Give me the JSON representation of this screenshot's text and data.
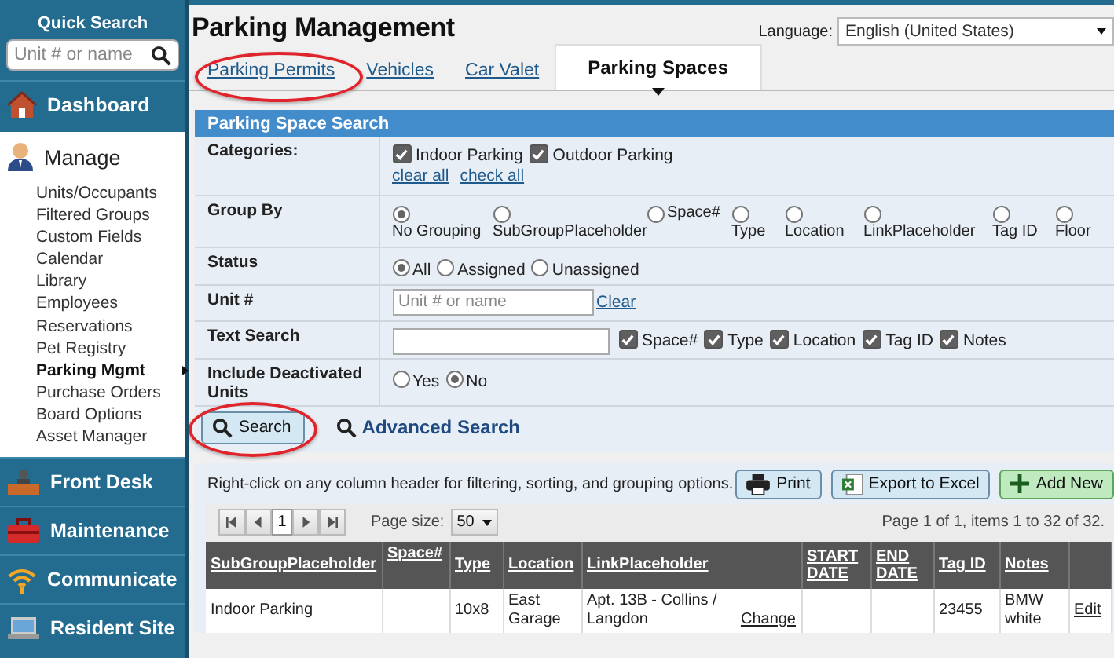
{
  "sidebar": {
    "quick_search": {
      "title": "Quick Search",
      "placeholder": "Unit # or name"
    },
    "sections": [
      {
        "label": "Dashboard",
        "expanded": false
      },
      {
        "label": "Manage",
        "expanded": true,
        "items": [
          {
            "label": "Units/Occupants",
            "selected": false
          },
          {
            "label": "Filtered Groups",
            "selected": false
          },
          {
            "label": "Custom Fields",
            "selected": false
          },
          {
            "label": "Calendar",
            "selected": false
          },
          {
            "label": "Library",
            "selected": false
          },
          {
            "label": "Employees",
            "selected": false
          },
          {
            "label": "Reservations",
            "selected": false
          },
          {
            "label": "Pet Registry",
            "selected": false
          },
          {
            "label": "Parking Mgmt",
            "selected": true
          },
          {
            "label": "Purchase Orders",
            "selected": false
          },
          {
            "label": "Board Options",
            "selected": false
          },
          {
            "label": "Asset Manager",
            "selected": false
          }
        ]
      },
      {
        "label": "Front Desk",
        "expanded": false
      },
      {
        "label": "Maintenance",
        "expanded": false
      },
      {
        "label": "Communicate",
        "expanded": false
      },
      {
        "label": "Resident Site",
        "expanded": false
      }
    ]
  },
  "page": {
    "title": "Parking Management",
    "language": {
      "label": "Language:",
      "value": "English (United States)"
    }
  },
  "tabs": [
    {
      "label": "Parking Permits",
      "selected": false,
      "circled": true
    },
    {
      "label": "Vehicles",
      "selected": false,
      "circled": false
    },
    {
      "label": "Car Valet",
      "selected": false,
      "circled": false
    },
    {
      "label": "Parking Spaces",
      "selected": true,
      "circled": false
    }
  ],
  "search_panel": {
    "title": "Parking Space Search",
    "rows": [
      {
        "kind": "checks",
        "label": "Categories:",
        "options": [
          {
            "label": "Indoor Parking",
            "checked": true
          },
          {
            "label": "Outdoor Parking",
            "checked": true
          }
        ],
        "links": [
          "clear all",
          "check all"
        ]
      },
      {
        "kind": "grouping",
        "label": "Group By",
        "options": [
          {
            "label": "No Grouping",
            "selected": true
          },
          {
            "label": "SubGroupPlaceholder",
            "selected": false
          },
          {
            "label": "Space#",
            "selected": false
          },
          {
            "label": "Type",
            "selected": false
          },
          {
            "label": "Location",
            "selected": false
          },
          {
            "label": "LinkPlaceholder",
            "selected": false
          },
          {
            "label": "Tag ID",
            "selected": false
          },
          {
            "label": "Floor",
            "selected": false
          }
        ]
      },
      {
        "kind": "radios",
        "label": "Status",
        "options": [
          {
            "label": "All",
            "selected": true
          },
          {
            "label": "Assigned",
            "selected": false
          },
          {
            "label": "Unassigned",
            "selected": false
          }
        ]
      },
      {
        "kind": "text",
        "label": "Unit #",
        "placeholder": "Unit # or name",
        "link": "Clear"
      },
      {
        "kind": "textchecks",
        "label": "Text Search",
        "options": [
          {
            "label": "Space#",
            "checked": true
          },
          {
            "label": "Type",
            "checked": true
          },
          {
            "label": "Location",
            "checked": true
          },
          {
            "label": "Tag ID",
            "checked": true
          },
          {
            "label": "Notes",
            "checked": true
          }
        ]
      },
      {
        "kind": "radios",
        "label": "Include Deactivated Units",
        "options": [
          {
            "label": "Yes",
            "selected": false
          },
          {
            "label": "No",
            "selected": true
          }
        ]
      }
    ],
    "search_button": {
      "label": "Search",
      "circled": true
    },
    "advanced_search": "Advanced Search"
  },
  "grid": {
    "hint": "Right-click on any column header for filtering, sorting, and grouping options.",
    "buttons": [
      {
        "kind": "print",
        "label": "Print"
      },
      {
        "kind": "excel",
        "label": "Export to Excel"
      },
      {
        "kind": "add",
        "label": "Add New"
      }
    ],
    "pager": {
      "page": "1",
      "page_size_label": "Page size:",
      "page_size": "50",
      "summary": "Page 1 of 1, items 1 to 32 of 32."
    },
    "columns": [
      "SubGroupPlaceholder",
      "Space#",
      "Type",
      "Location",
      "LinkPlaceholder",
      "START DATE",
      "END DATE",
      "Tag ID",
      "Notes"
    ],
    "rows": [
      {
        "subgroup": "Indoor Parking",
        "type": "10x8",
        "location": "East Garage",
        "link": "Apt. 13B - Collins / Langdon",
        "link_action": "Change",
        "tag_id": "23455",
        "notes": "BMW white",
        "action": "Edit"
      }
    ]
  }
}
